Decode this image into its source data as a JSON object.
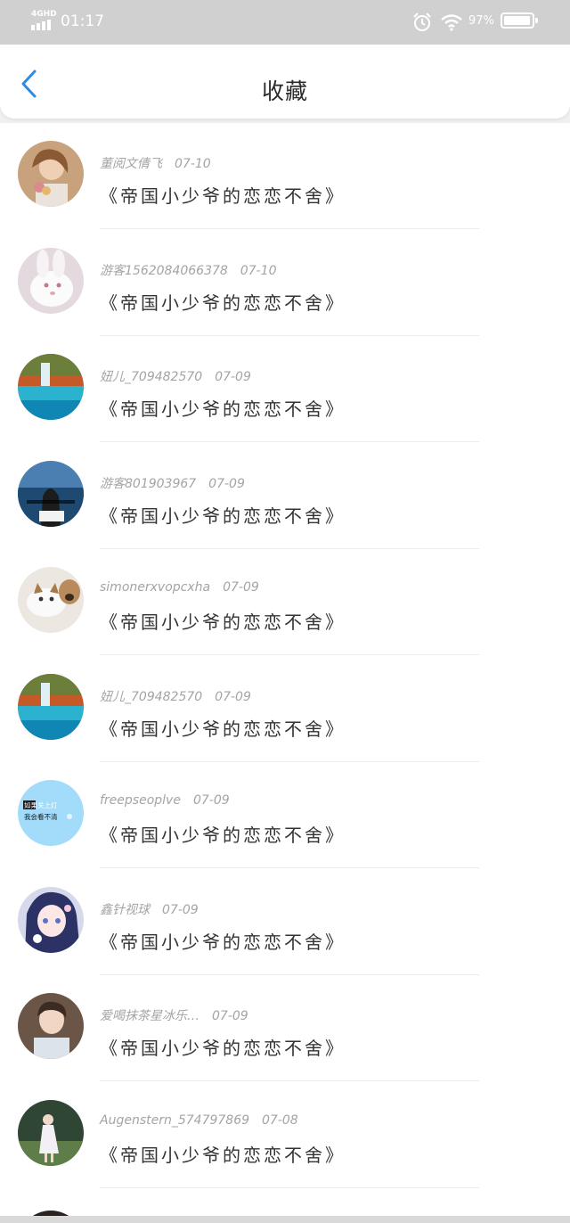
{
  "status_bar": {
    "network": "4GHD",
    "time": "01:17",
    "battery_percent": "97%",
    "battery_level": 0.97,
    "icons": [
      "alarm-icon",
      "wifi-icon",
      "battery-icon"
    ]
  },
  "header": {
    "back_icon": "chevron-left-icon",
    "title": "收藏",
    "accent_color": "#2b8be6"
  },
  "favorites": [
    {
      "user": "董阅文倩飞",
      "date": "07-10",
      "book": "《帝国小少爷的恋恋不舍》",
      "avatar": "girl-with-flowers"
    },
    {
      "user": "游客1562084066378",
      "date": "07-10",
      "book": "《帝国小少爷的恋恋不舍》",
      "avatar": "white-rabbit"
    },
    {
      "user": "妞儿_709482570",
      "date": "07-09",
      "book": "《帝国小少爷的恋恋不舍》",
      "avatar": "waterfall-lake"
    },
    {
      "user": "游客801903967",
      "date": "07-09",
      "book": "《帝国小少爷的恋恋不舍》",
      "avatar": "girl-by-sea"
    },
    {
      "user": "simonerxvopcxha",
      "date": "07-09",
      "book": "《帝国小少爷的恋恋不舍》",
      "avatar": "cat-and-dog"
    },
    {
      "user": "妞儿_709482570",
      "date": "07-09",
      "book": "《帝国小少爷的恋恋不舍》",
      "avatar": "waterfall-lake"
    },
    {
      "user": "freepseoplve",
      "date": "07-09",
      "book": "《帝国小少爷的恋恋不舍》",
      "avatar": "text-badge",
      "avatar_text": [
        "如果关上灯",
        "我会看不清"
      ]
    },
    {
      "user": "鑫针视球",
      "date": "07-09",
      "book": "《帝国小少爷的恋恋不舍》",
      "avatar": "anime-girl"
    },
    {
      "user": "爱喝抹茶星冰乐…",
      "date": "07-09",
      "book": "《帝国小少爷的恋恋不舍》",
      "avatar": "young-man"
    },
    {
      "user": "Augenstern_574797869",
      "date": "07-08",
      "book": "《帝国小少爷的恋恋不舍》",
      "avatar": "girl-in-field"
    }
  ]
}
